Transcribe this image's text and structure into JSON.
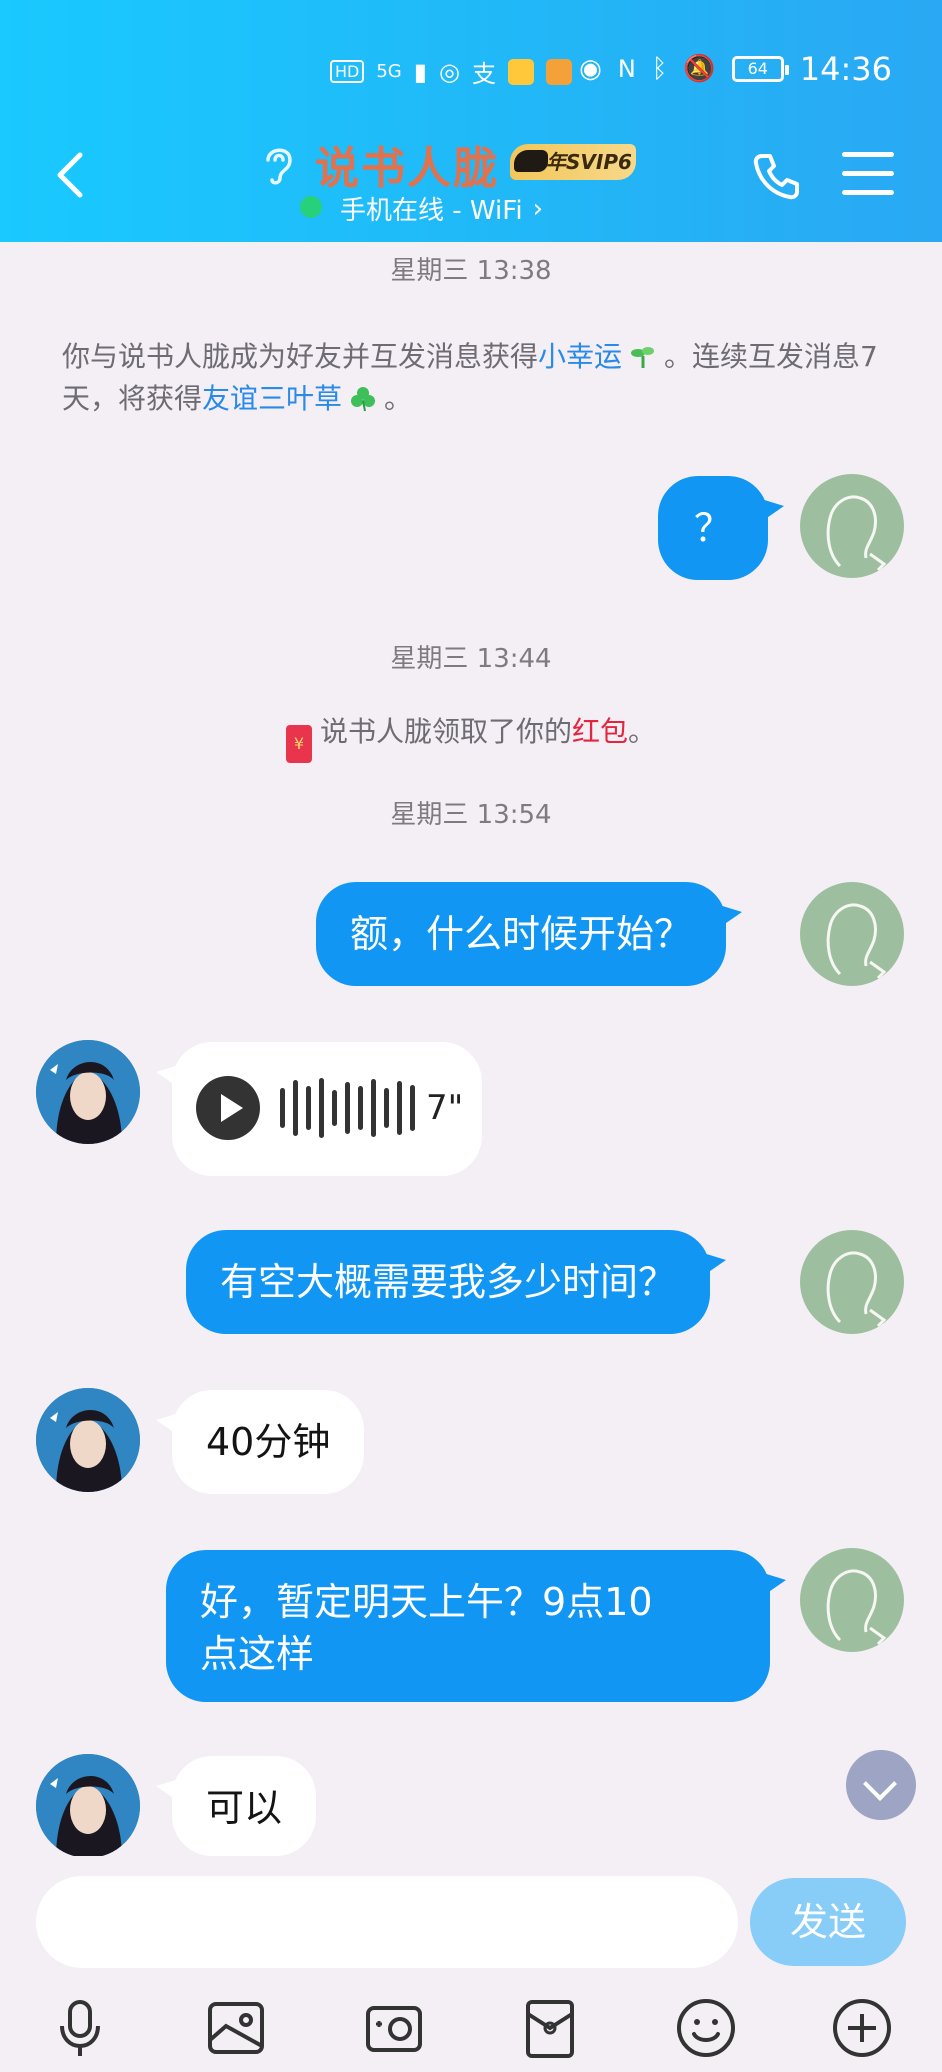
{
  "status_bar": {
    "network": "5G",
    "battery": "64",
    "time": "14:36"
  },
  "header": {
    "contact_name": "说书人胧",
    "svip_label": "年SVIP6",
    "online_status": "手机在线 - WiFi",
    "online_chevron": "›"
  },
  "messages": {
    "ts1": "星期三 13:38",
    "friend_notice": {
      "part1": "你与说书人胧成为好友并互发消息获得",
      "link1": "小幸运",
      "part2": "。连续互发消息7天，将获得",
      "link2": "友谊三叶草",
      "part3": "。"
    },
    "m1": "？",
    "ts2": "星期三 13:44",
    "redpacket": {
      "prefix": "说书人胧领取了你的",
      "link": "红包",
      "suffix": "。",
      "icon_char": "¥"
    },
    "ts3": "星期三 13:54",
    "m2": "额，什么时候开始？",
    "voice_duration": "7\"",
    "m3": "有空大概需要我多少时间？",
    "m4": "40分钟",
    "m5_line1": "好，暂定明天上午？9点10",
    "m5_line2": "点这样",
    "m6": "可以"
  },
  "input": {
    "placeholder": "",
    "send_label": "发送"
  },
  "colors": {
    "header_gradient_start": "#19c9ff",
    "my_bubble": "#1296f3",
    "link_blue": "#2a8ae8",
    "red_link": "#e5243f",
    "send_button": "#87cdf7"
  },
  "icons": [
    "back-icon",
    "ear-icon",
    "phone-icon",
    "menu-icon",
    "mic-icon",
    "image-icon",
    "camera-icon",
    "redpacket-icon",
    "emoji-icon",
    "plus-icon",
    "scroll-down-icon"
  ]
}
